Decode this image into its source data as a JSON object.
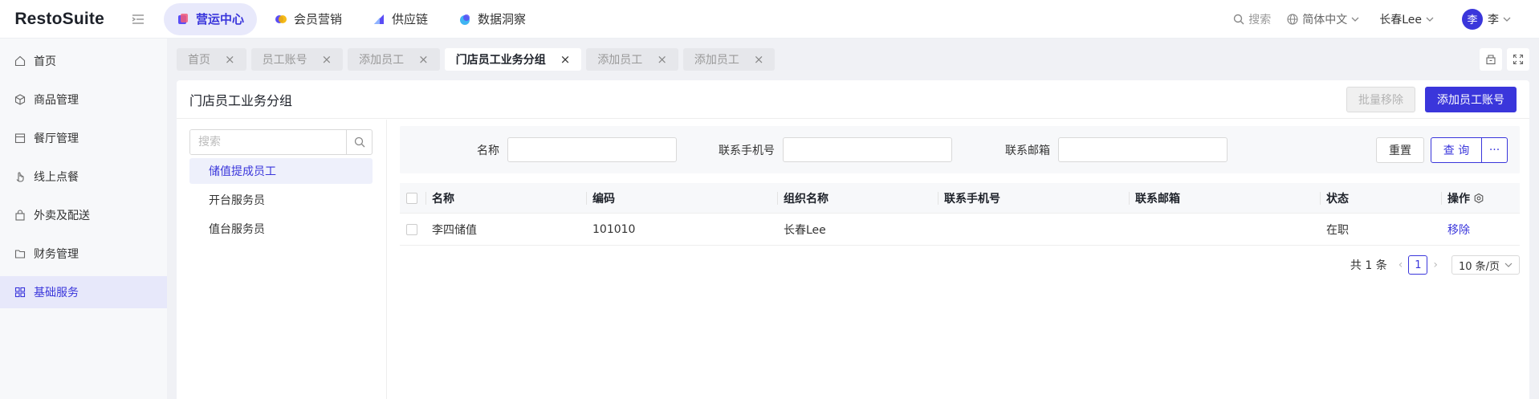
{
  "app": {
    "name": "RestoSuite"
  },
  "topnav": [
    {
      "label": "营运中心",
      "active": true
    },
    {
      "label": "会员营销",
      "active": false
    },
    {
      "label": "供应链",
      "active": false
    },
    {
      "label": "数据洞察",
      "active": false
    }
  ],
  "header_right": {
    "search_label": "搜索",
    "language": "简体中文",
    "store": "长春Lee",
    "avatar_initial": "李",
    "user": "李"
  },
  "sidebar": [
    {
      "label": "首页",
      "icon": "home-icon",
      "active": false
    },
    {
      "label": "商品管理",
      "icon": "cube-icon",
      "active": false
    },
    {
      "label": "餐厅管理",
      "icon": "store-icon",
      "active": false
    },
    {
      "label": "线上点餐",
      "icon": "hand-icon",
      "active": false
    },
    {
      "label": "外卖及配送",
      "icon": "bag-icon",
      "active": false
    },
    {
      "label": "财务管理",
      "icon": "folder-icon",
      "active": false
    },
    {
      "label": "基础服务",
      "icon": "grid-icon",
      "active": true
    }
  ],
  "tabs": [
    {
      "label": "首页",
      "active": false
    },
    {
      "label": "员工账号",
      "active": false
    },
    {
      "label": "添加员工",
      "active": false
    },
    {
      "label": "门店员工业务分组",
      "active": true
    },
    {
      "label": "添加员工",
      "active": false
    },
    {
      "label": "添加员工",
      "active": false
    }
  ],
  "page": {
    "title": "门店员工业务分组",
    "batch_remove": "批量移除",
    "add_account": "添加员工账号"
  },
  "tree": {
    "search_placeholder": "搜索",
    "items": [
      {
        "label": "储值提成员工",
        "active": true
      },
      {
        "label": "开台服务员",
        "active": false
      },
      {
        "label": "值台服务员",
        "active": false
      }
    ]
  },
  "filter": {
    "name_label": "名称",
    "phone_label": "联系手机号",
    "email_label": "联系邮箱",
    "reset": "重置",
    "query": "查 询",
    "more": "···"
  },
  "table": {
    "columns": [
      "名称",
      "编码",
      "组织名称",
      "联系手机号",
      "联系邮箱",
      "状态",
      "操作"
    ],
    "rows": [
      {
        "name": "李四储值",
        "code": "101010",
        "org": "长春Lee",
        "phone": "",
        "email": "",
        "status": "在职",
        "action": "移除"
      }
    ]
  },
  "pagination": {
    "total": "共 1 条",
    "current": "1",
    "page_size": "10 条/页"
  },
  "colors": {
    "accent": "#3a36db",
    "accent_bg": "#e8e9fb"
  }
}
